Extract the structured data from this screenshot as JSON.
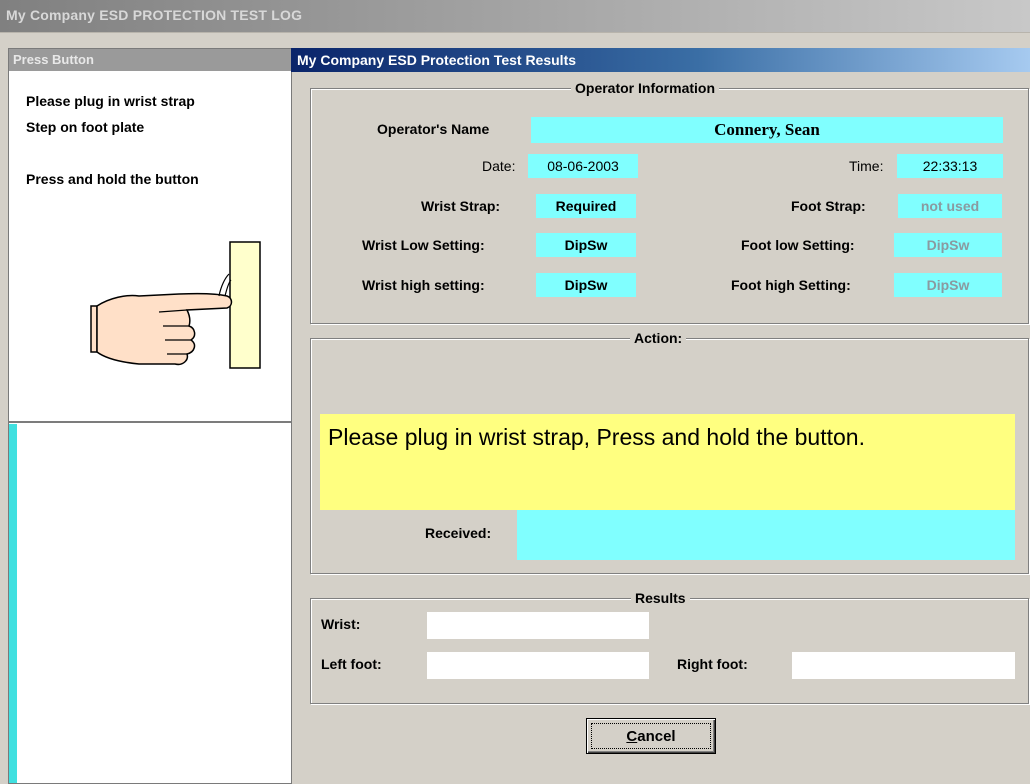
{
  "window": {
    "title": "My Company ESD PROTECTION TEST LOG"
  },
  "left_panel": {
    "title": "Press Button",
    "instructions": [
      "Please plug in wrist strap",
      "Step on foot plate",
      "Press and hold the button"
    ],
    "illustration_icon": "finger-pressing-button-icon"
  },
  "right_panel": {
    "title": "My Company ESD Protection Test Results",
    "operator_info": {
      "legend": "Operator Information",
      "name_label": "Operator's Name",
      "name_value": "Connery, Sean",
      "date_label": "Date:",
      "date_value": "08-06-2003",
      "time_label": "Time:",
      "time_value": "22:33:13",
      "wrist_strap_label": "Wrist Strap:",
      "wrist_strap_value": "Required",
      "foot_strap_label": "Foot Strap:",
      "foot_strap_value": "not used",
      "wrist_low_label": "Wrist Low Setting:",
      "wrist_low_value": "DipSw",
      "foot_low_label": "Foot low Setting:",
      "foot_low_value": "DipSw",
      "wrist_high_label": "Wrist high setting:",
      "wrist_high_value": "DipSw",
      "foot_high_label": "Foot high Setting:",
      "foot_high_value": "DipSw"
    },
    "action": {
      "legend": "Action:",
      "message": "Please plug in wrist strap, Press and hold the button.",
      "received_label": "Received:",
      "received_value": ""
    },
    "results": {
      "legend": "Results",
      "wrist_label": "Wrist:",
      "wrist_value": "",
      "left_foot_label": "Left foot:",
      "left_foot_value": "",
      "right_foot_label": "Right foot:",
      "right_foot_value": ""
    },
    "cancel_label": "Cancel"
  },
  "colors": {
    "value_field": "#80ffff",
    "action_message_bg": "#ffff80",
    "title_active": "#0a246a"
  }
}
